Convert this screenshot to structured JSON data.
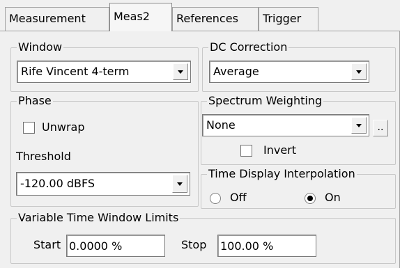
{
  "tabs": [
    {
      "label": "Measurement",
      "active": false
    },
    {
      "label": "Meas2",
      "active": true
    },
    {
      "label": "References",
      "active": false
    },
    {
      "label": "Trigger",
      "active": false
    }
  ],
  "window_group": {
    "legend": "Window",
    "value": "Rife Vincent 4-term"
  },
  "dc_group": {
    "legend": "DC Correction",
    "value": "Average"
  },
  "phase_group": {
    "legend": "Phase",
    "unwrap_label": "Unwrap",
    "unwrap_checked": false,
    "threshold_label": "Threshold",
    "threshold_value": "-120.00 dBFS"
  },
  "spectrum_group": {
    "legend": "Spectrum Weighting",
    "value": "None",
    "more_label": "..",
    "invert_label": "Invert",
    "invert_checked": false
  },
  "interp_group": {
    "legend": "Time Display Interpolation",
    "off_label": "Off",
    "on_label": "On",
    "selected": "On"
  },
  "limits_group": {
    "legend": "Variable Time Window Limits",
    "start_label": "Start",
    "start_value": "0.0000 %",
    "stop_label": "Stop",
    "stop_value": "100.00 %"
  },
  "icons": {
    "dropdown": "chevron-down-icon",
    "radio_selected": "radio-dot-icon"
  }
}
